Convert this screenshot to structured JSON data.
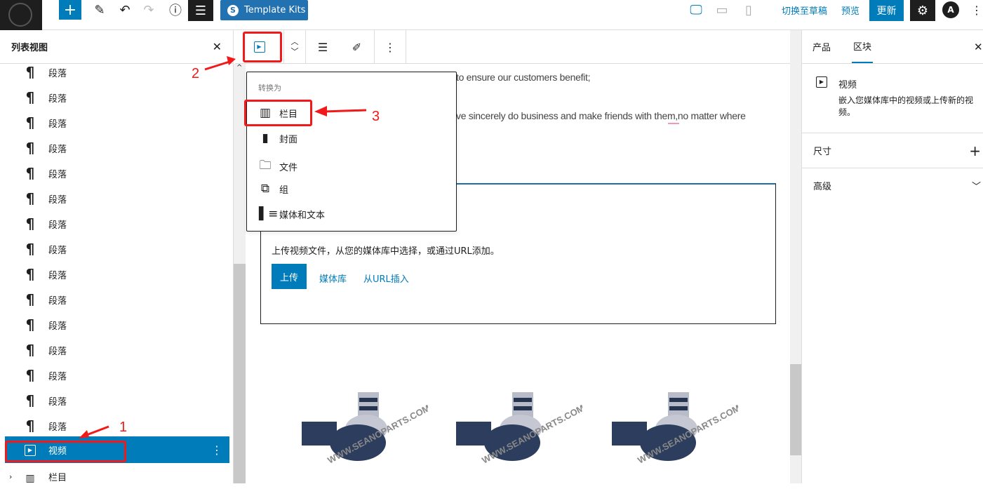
{
  "topbar": {
    "template_kits": "Template Kits",
    "switch_draft": "切换至草稿",
    "preview": "预览",
    "update": "更新",
    "avatar_letter": "A"
  },
  "list_view": {
    "title": "列表视图",
    "items": [
      {
        "label": "段落",
        "icon": "paragraph-icon"
      },
      {
        "label": "段落",
        "icon": "paragraph-icon"
      },
      {
        "label": "段落",
        "icon": "paragraph-icon"
      },
      {
        "label": "段落",
        "icon": "paragraph-icon"
      },
      {
        "label": "段落",
        "icon": "paragraph-icon"
      },
      {
        "label": "段落",
        "icon": "paragraph-icon"
      },
      {
        "label": "段落",
        "icon": "paragraph-icon"
      },
      {
        "label": "段落",
        "icon": "paragraph-icon"
      },
      {
        "label": "段落",
        "icon": "paragraph-icon"
      },
      {
        "label": "段落",
        "icon": "paragraph-icon"
      },
      {
        "label": "段落",
        "icon": "paragraph-icon"
      },
      {
        "label": "段落",
        "icon": "paragraph-icon"
      },
      {
        "label": "段落",
        "icon": "paragraph-icon"
      },
      {
        "label": "段落",
        "icon": "paragraph-icon"
      },
      {
        "label": "段落",
        "icon": "paragraph-icon"
      },
      {
        "label": "视频",
        "icon": "video-icon",
        "selected": true
      },
      {
        "label": "栏目",
        "icon": "columns-icon"
      }
    ]
  },
  "transform_menu": {
    "heading": "转换为",
    "items": [
      {
        "label": "栏目",
        "icon": "columns-icon"
      },
      {
        "label": "封面",
        "icon": "cover-icon"
      },
      {
        "label": "文件",
        "icon": "file-icon"
      },
      {
        "label": "组",
        "icon": "group-icon"
      },
      {
        "label": "媒体和文本",
        "icon": "media-text-icon"
      }
    ]
  },
  "content": {
    "para1": "to ensure our customers benefit;",
    "para2": "ve sincerely do business and make friends with them,no matter where",
    "video_instructions": "上传视频文件，从您的媒体库中选择，或通过URL添加。",
    "upload": "上传",
    "media_library": "媒体库",
    "insert_url": "从URL插入",
    "watermark": "WWW.SEANOPARTS.COM"
  },
  "sidebar": {
    "tabs": [
      "产品",
      "区块"
    ],
    "active_tab": "区块",
    "block_name": "视频",
    "block_desc": "嵌入您媒体库中的视频或上传新的视频。",
    "sections": [
      "尺寸",
      "高级"
    ]
  },
  "annotations": [
    "1",
    "2",
    "3"
  ],
  "colors": {
    "accent": "#007cba",
    "annotation": "#f2191b"
  }
}
